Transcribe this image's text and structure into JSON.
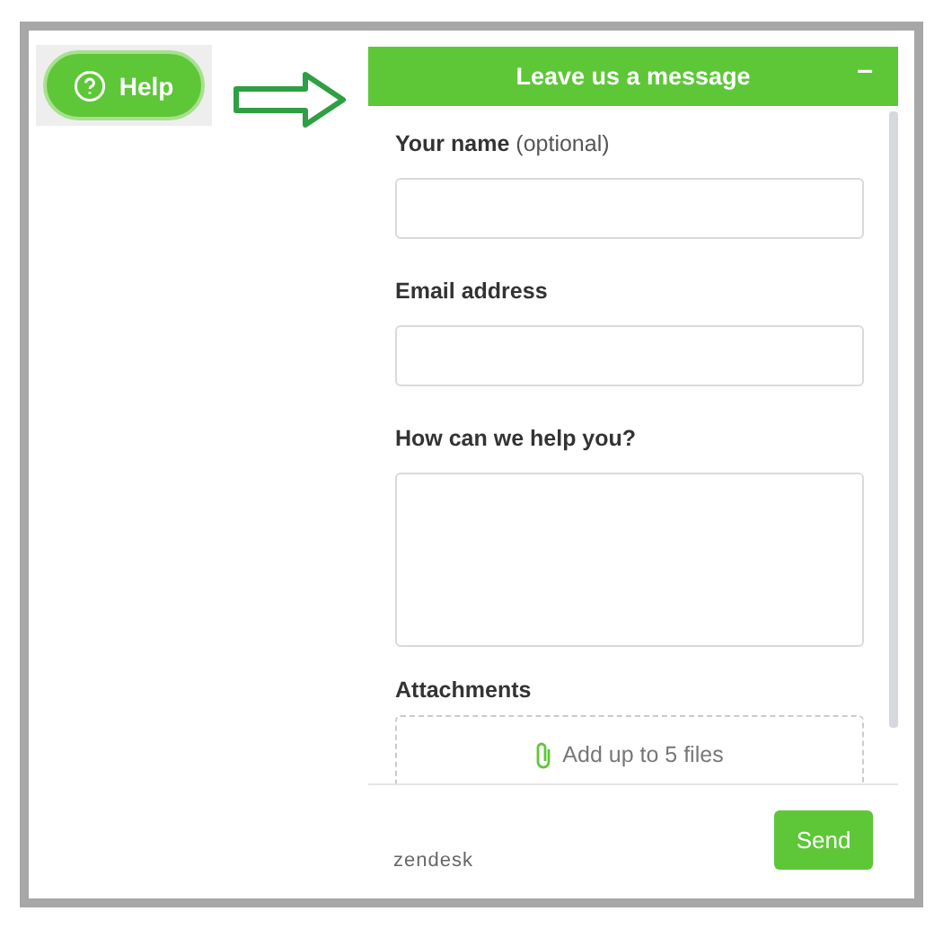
{
  "launcher": {
    "label": "Help"
  },
  "widget": {
    "title": "Leave us a message",
    "minimize": "–",
    "fields": [
      {
        "kind": "input",
        "label": "Your name",
        "hint": "(optional)"
      },
      {
        "kind": "input",
        "label": "Email address"
      },
      {
        "kind": "textarea",
        "label": "How can we help you?"
      }
    ],
    "attachments": {
      "label": "Attachments",
      "dropzone": "Add up to 5 files"
    },
    "footer": {
      "brand": "zendesk",
      "send": "Send"
    }
  }
}
